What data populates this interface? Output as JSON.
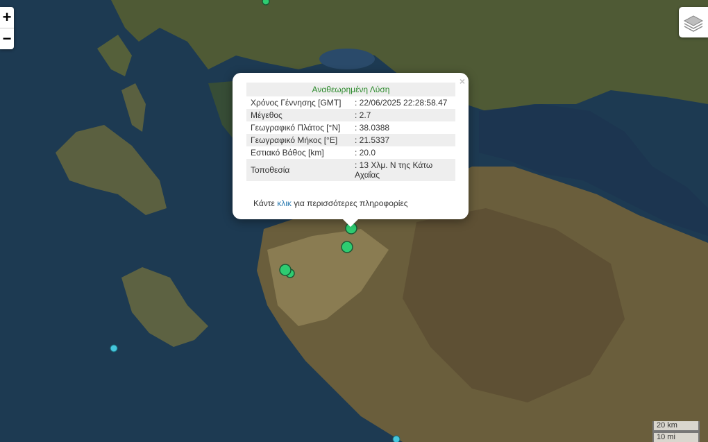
{
  "controls": {
    "zoom_in": "+",
    "zoom_out": "−",
    "close": "×"
  },
  "popup": {
    "heading": "Αναθεωρημένη Λύση",
    "rows": [
      {
        "label": "Χρόνος Γέννησης [GMT]",
        "value": ": 22/06/2025 22:28:58.47"
      },
      {
        "label": "Μέγεθος",
        "value": ": 2.7"
      },
      {
        "label": "Γεωγραφικό Πλάτος [°N]",
        "value": ": 38.0388"
      },
      {
        "label": "Γεωγραφικό Μήκος [°E]",
        "value": ": 21.5337"
      },
      {
        "label": "Εστιακό Βάθος [km]",
        "value": ": 20.0"
      },
      {
        "label": "Τοποθεσία",
        "value": ": 13 Χλμ. Ν της Κάτω Αχαΐας"
      }
    ],
    "footer_before": "Κάντε ",
    "footer_link": "κλικ",
    "footer_after": " για περισσότερες πληροφορίες"
  },
  "scale": {
    "metric": "20 km",
    "imperial": "10 mi"
  },
  "colors": {
    "sea": "#1d3a52",
    "land": "#5b5a3a",
    "marker_recent": "#2ecc71",
    "marker_other": "#45c6dc"
  }
}
